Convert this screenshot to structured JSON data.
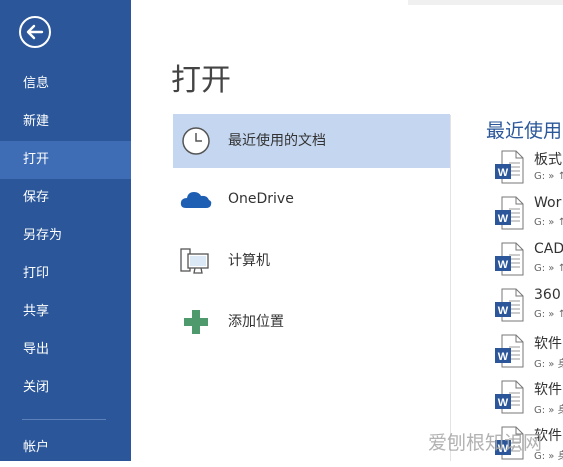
{
  "sidebar": {
    "back_icon": "back-arrow-icon",
    "items": [
      {
        "label": "信息"
      },
      {
        "label": "新建"
      },
      {
        "label": "打开",
        "active": true
      },
      {
        "label": "保存"
      },
      {
        "label": "另存为"
      },
      {
        "label": "打印"
      },
      {
        "label": "共享"
      },
      {
        "label": "导出"
      },
      {
        "label": "关闭"
      },
      {
        "label": "帐户"
      }
    ],
    "colors": {
      "background": "#2b579a",
      "active": "#3e6db5"
    }
  },
  "main": {
    "title": "打开",
    "locations": [
      {
        "label": "最近使用的文档",
        "icon": "clock-icon",
        "active": true
      },
      {
        "label": "OneDrive",
        "icon": "cloud-icon"
      },
      {
        "label": "计算机",
        "icon": "computer-icon"
      },
      {
        "label": "添加位置",
        "icon": "plus-icon"
      }
    ]
  },
  "recent": {
    "heading": "最近使用",
    "files": [
      {
        "name": "板式",
        "path": "G: » ↑"
      },
      {
        "name": "Wor",
        "path": "G: » ↑"
      },
      {
        "name": "CAD",
        "path": "G: » ↑"
      },
      {
        "name": "360",
        "path": "G: » ↑"
      },
      {
        "name": "软件",
        "path": "G: » 身"
      },
      {
        "name": "软件",
        "path": "G: » 身"
      },
      {
        "name": "软件",
        "path": "G: » 身"
      }
    ]
  },
  "watermark": "爱刨根知识网"
}
